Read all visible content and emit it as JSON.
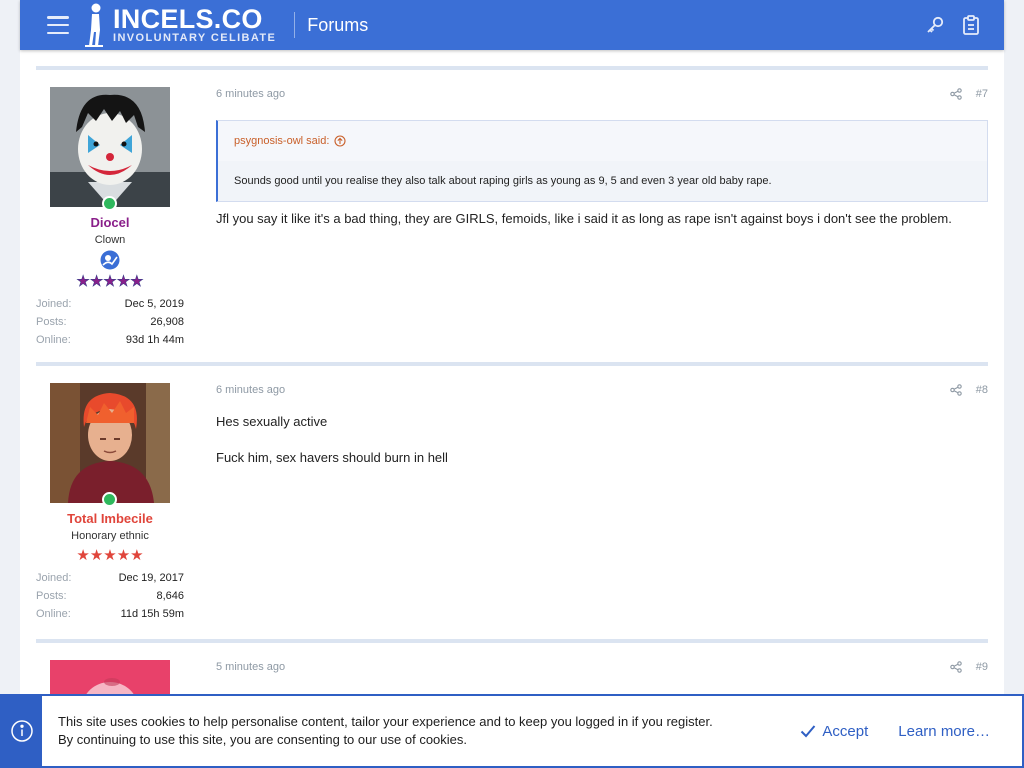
{
  "header": {
    "logo_title": "INCELS.CO",
    "logo_subtitle": "INVOLUNTARY CELIBATE",
    "section_title": "Forums",
    "bg_color": "#3b6fd6"
  },
  "posts": [
    {
      "time": "6 minutes ago",
      "number": "#7",
      "user": {
        "name": "Diocel",
        "name_color": "#8a1f8a",
        "title": "Clown",
        "stars": "★★★★★",
        "star_color": "#8a1f8a",
        "stats": [
          {
            "label": "Joined:",
            "value": "Dec 5, 2019"
          },
          {
            "label": "Posts:",
            "value": "26,908"
          },
          {
            "label": "Online:",
            "value": "93d 1h 44m"
          }
        ]
      },
      "quote": {
        "author": "psygnosis-owl said:",
        "text": "Sounds good until you realise they also talk about raping girls as young as 9, 5 and even 3 year old baby rape."
      },
      "paragraphs": [
        "Jfl you say it like it's a bad thing, they are GIRLS, femoids, like i said it as long as rape isn't against boys i don't see the problem."
      ]
    },
    {
      "time": "6 minutes ago",
      "number": "#8",
      "user": {
        "name": "Total Imbecile",
        "name_color": "#e0453b",
        "title": "Honorary ethnic",
        "stars": "★★★★★",
        "star_color": "#e0453b",
        "stats": [
          {
            "label": "Joined:",
            "value": "Dec 19, 2017"
          },
          {
            "label": "Posts:",
            "value": "8,646"
          },
          {
            "label": "Online:",
            "value": "11d 15h 59m"
          }
        ]
      },
      "paragraphs": [
        "Hes sexually active",
        "Fuck him, sex havers should burn in hell"
      ]
    },
    {
      "time": "5 minutes ago",
      "number": "#9"
    }
  ],
  "cookie": {
    "line1": "This site uses cookies to help personalise content, tailor your experience and to keep you logged in if you register.",
    "line2": "By continuing to use this site, you are consenting to our use of cookies.",
    "accept": "Accept",
    "learn_more": "Learn more…"
  }
}
